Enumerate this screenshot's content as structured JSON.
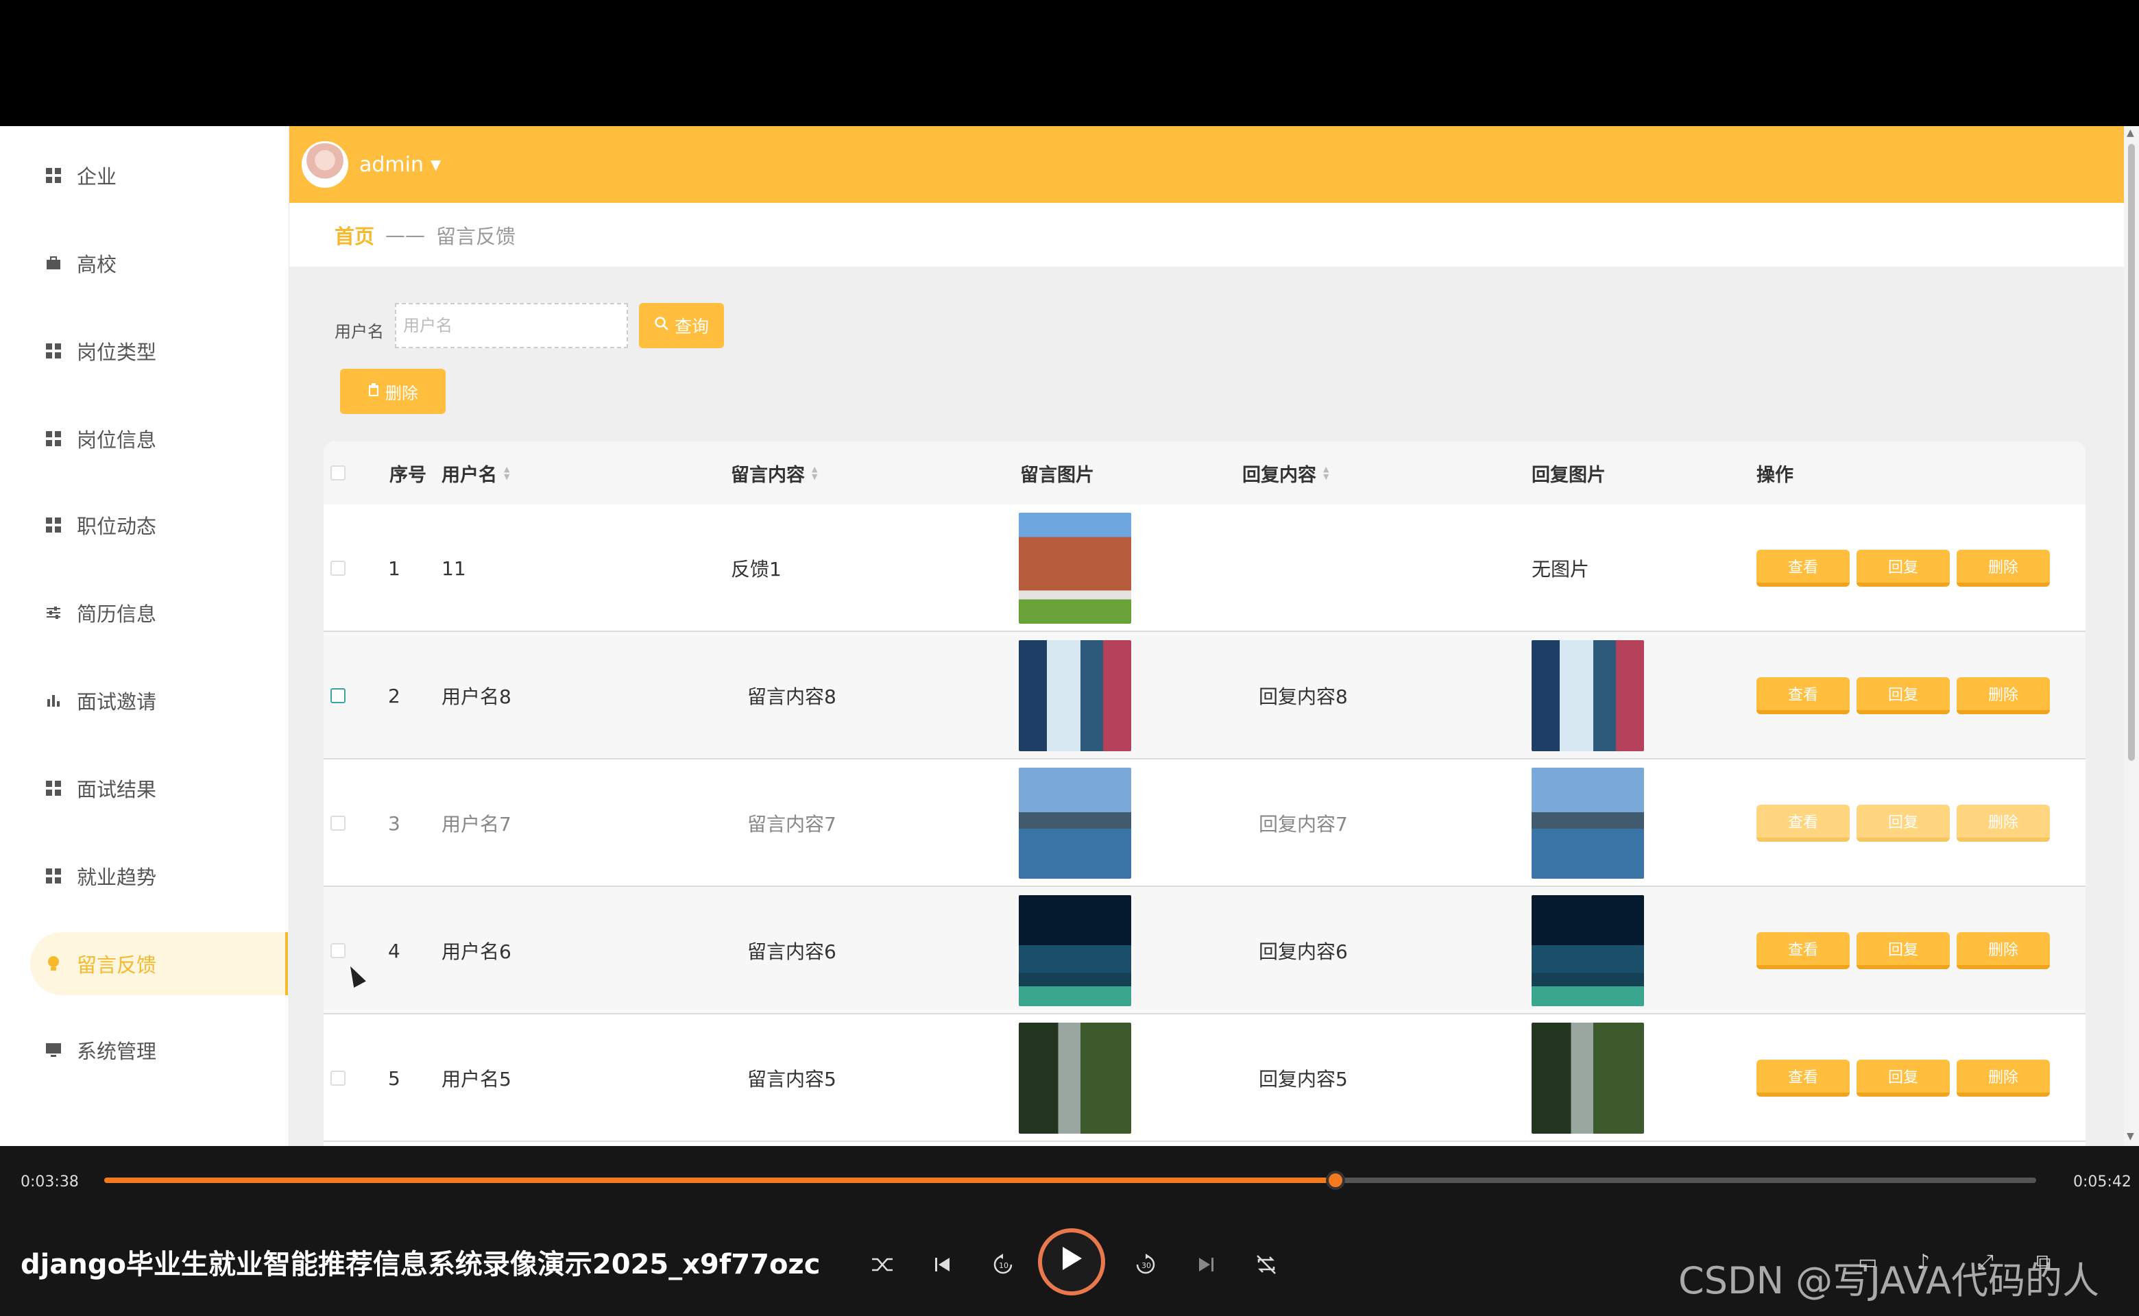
{
  "app": {
    "header": {
      "username": "admin"
    },
    "breadcrumb": {
      "home": "首页",
      "separator": "——",
      "current": "留言反馈"
    },
    "sidebar": {
      "items": [
        {
          "label": "企业",
          "icon": "grid-icon"
        },
        {
          "label": "高校",
          "icon": "briefcase-icon"
        },
        {
          "label": "岗位类型",
          "icon": "grid-icon"
        },
        {
          "label": "岗位信息",
          "icon": "grid-icon"
        },
        {
          "label": "职位动态",
          "icon": "grid-icon"
        },
        {
          "label": "简历信息",
          "icon": "sliders-icon"
        },
        {
          "label": "面试邀请",
          "icon": "bar-chart-icon"
        },
        {
          "label": "面试结果",
          "icon": "grid-icon"
        },
        {
          "label": "就业趋势",
          "icon": "grid-icon"
        },
        {
          "label": "留言反馈",
          "icon": "bulb-icon",
          "active": true
        },
        {
          "label": "系统管理",
          "icon": "monitor-icon"
        }
      ]
    },
    "search": {
      "label": "用户名",
      "placeholder": "用户名",
      "value": "",
      "query_button": "查询"
    },
    "toolbar": {
      "delete_button": "删除"
    },
    "table": {
      "columns": {
        "index": "序号",
        "username": "用户名",
        "content": "留言内容",
        "image": "留言图片",
        "reply": "回复内容",
        "reply_image": "回复图片",
        "actions": "操作"
      },
      "action_labels": {
        "view": "查看",
        "reply": "回复",
        "delete": "删除"
      },
      "rows": [
        {
          "index": "1",
          "username": "11",
          "content": "反馈1",
          "image": "building-photo",
          "reply": "",
          "reply_image_text": "无图片"
        },
        {
          "index": "2",
          "username": "用户名8",
          "content": "留言内容8",
          "image": "waterfall-photo",
          "reply": "回复内容8",
          "reply_image": "waterfall-photo"
        },
        {
          "index": "3",
          "username": "用户名7",
          "content": "留言内容7",
          "image": "lake-photo",
          "reply": "回复内容7",
          "reply_image": "lake-photo"
        },
        {
          "index": "4",
          "username": "用户名6",
          "content": "留言内容6",
          "image": "night-sky-photo",
          "reply": "回复内容6",
          "reply_image": "night-sky-photo"
        },
        {
          "index": "5",
          "username": "用户名5",
          "content": "留言内容5",
          "image": "forest-waterfall-photo",
          "reply": "回复内容5",
          "reply_image": "forest-waterfall-photo"
        }
      ]
    },
    "colors": {
      "accent": "#ffbe3d",
      "active_text": "#f5b92b",
      "content_bg": "#efefef"
    }
  },
  "player": {
    "current_time": "0:03:38",
    "total_time": "0:05:42",
    "progress": 0.6374,
    "title": "django毕业生就业智能推荐信息系统录像演示2025_x9f77ozc",
    "watermark": "CSDN @写JAVA代码的人",
    "accent": "#f47a20"
  }
}
